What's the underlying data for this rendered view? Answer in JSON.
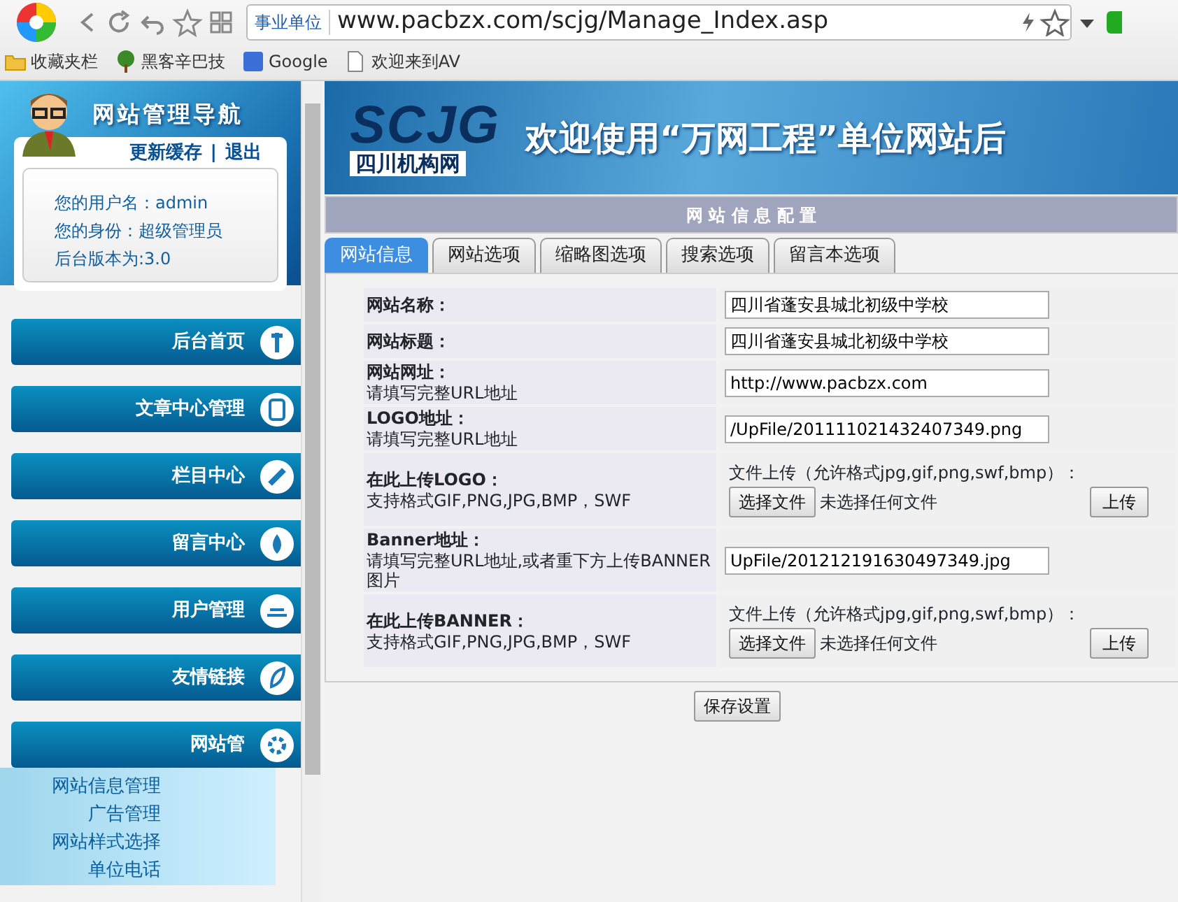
{
  "browser": {
    "address": {
      "badge": "事业单位",
      "url": "www.pacbzx.com/scjg/Manage_Index.asp"
    },
    "bookmarks": [
      "收藏夹栏",
      "黑客辛巴技",
      "Google",
      "欢迎来到AV"
    ]
  },
  "sidebar": {
    "title": "网站管理导航",
    "links": [
      "更新缓存",
      "|",
      "退出"
    ],
    "user_info": [
      "您的用户名：admin",
      "您的身份：超级管理员",
      "后台版本为:3.0"
    ],
    "menu": [
      {
        "label": "后台首页"
      },
      {
        "label": "文章中心管理"
      },
      {
        "label": "栏目中心"
      },
      {
        "label": "留言中心"
      },
      {
        "label": "用户管理"
      },
      {
        "label": "友情链接"
      },
      {
        "label": "网站管"
      }
    ],
    "submenu": [
      "网站信息管理",
      "广告管理",
      "网站样式选择",
      "单位电话"
    ]
  },
  "main": {
    "banner": {
      "logo": "SCJG",
      "logo_subtitle": "四川机构网",
      "heading": "欢迎使用“万网工程”单位网站后"
    },
    "panel_title": "网 站 信 息 配 置",
    "tabs": [
      {
        "label": "网站信息",
        "selected": true
      },
      {
        "label": "网站选项",
        "selected": false
      },
      {
        "label": "缩略图选项",
        "selected": false
      },
      {
        "label": "搜索选项",
        "selected": false
      },
      {
        "label": "留言本选项",
        "selected": false
      }
    ],
    "rows": [
      {
        "kind": "text",
        "label": "网站名称：",
        "value": "四川省蓬安县城北初级中学校"
      },
      {
        "kind": "text",
        "label": "网站标题：",
        "value": "四川省蓬安县城北初级中学校"
      },
      {
        "kind": "text",
        "label": "网站网址：",
        "hint": "请填写完整URL地址",
        "value": "http://www.pacbzx.com"
      },
      {
        "kind": "text",
        "label": "LOGO地址：",
        "hint": "请填写完整URL地址",
        "value": "/UpFile/201111021432407349.png"
      },
      {
        "kind": "upload",
        "label": "在此上传LOGO：",
        "hint": "支持格式GIF,PNG,JPG,BMP，SWF",
        "upload_label": "文件上传（允许格式jpg,gif,png,swf,bmp）：",
        "choose_button": "选择文件",
        "no_file": "未选择任何文件",
        "upload_button": "上传"
      },
      {
        "kind": "text",
        "label": "Banner地址：",
        "hint": "请填写完整URL地址,或者重下方上传BANNER图片",
        "value": "UpFile/201212191630497349.jpg"
      },
      {
        "kind": "upload",
        "label": "在此上传BANNER：",
        "hint": "支持格式GIF,PNG,JPG,BMP，SWF",
        "upload_label": "文件上传（允许格式jpg,gif,png,swf,bmp）：",
        "choose_button": "选择文件",
        "no_file": "未选择任何文件",
        "upload_button": "上传"
      }
    ],
    "save_button": "保存设置"
  }
}
